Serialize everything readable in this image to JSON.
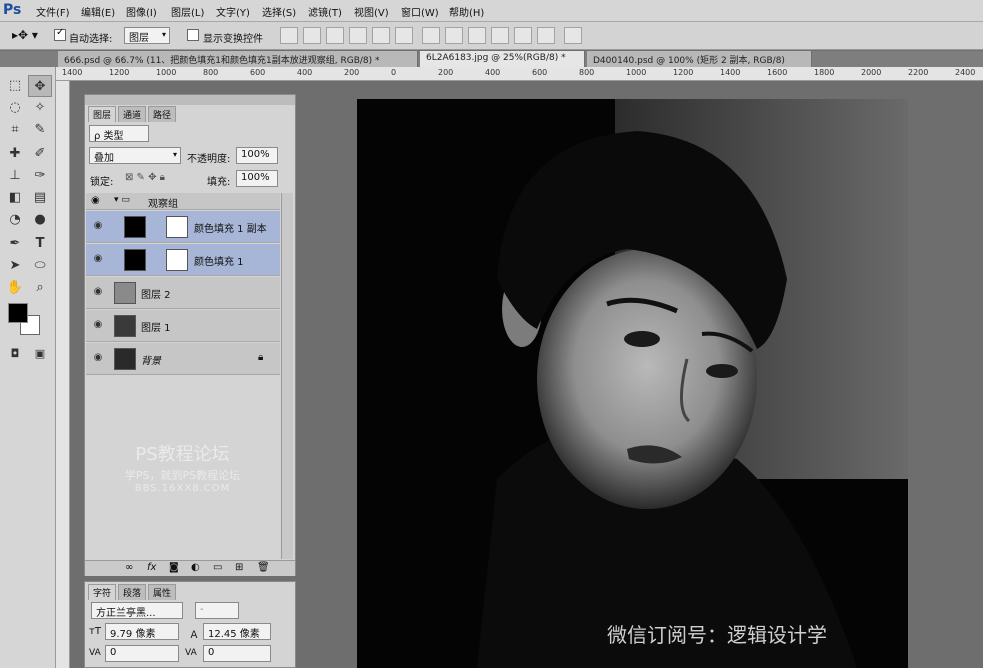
{
  "app": {
    "logo": "Ps"
  },
  "menu": [
    "文件(F)",
    "编辑(E)",
    "图像(I)",
    "图层(L)",
    "文字(Y)",
    "选择(S)",
    "滤镜(T)",
    "视图(V)",
    "窗口(W)",
    "帮助(H)"
  ],
  "options": {
    "auto_select_label": "自动选择:",
    "auto_select_value": "图层",
    "show_transform_label": "显示变换控件"
  },
  "tabs": [
    {
      "label": "666.psd @ 66.7% (11、把颜色填充1和颜色填充1副本放进观察组, RGB/8) *"
    },
    {
      "label": "6L2A6183.jpg @ 25%(RGB/8) *"
    },
    {
      "label": "D400140.psd @ 100% (矩形 2 副本, RGB/8)"
    }
  ],
  "ruler": {
    "labels": [
      "1400",
      "1200",
      "1000",
      "800",
      "600",
      "400",
      "200",
      "0",
      "200",
      "400",
      "600",
      "800",
      "1000",
      "1200",
      "1400",
      "1600",
      "1800",
      "2000",
      "2200",
      "2400"
    ]
  },
  "layers_panel": {
    "tabs": [
      "图层",
      "通道",
      "路径"
    ],
    "filter_label": "ρ 类型",
    "blend_mode": "叠加",
    "opacity_label": "不透明度:",
    "opacity_value": "100%",
    "lock_label": "锁定:",
    "fill_label": "填充:",
    "fill_value": "100%",
    "group_name": "观察组",
    "layers": [
      {
        "name": "颜色填充 1 副本"
      },
      {
        "name": "颜色填充 1"
      },
      {
        "name": "图层 2"
      },
      {
        "name": "图层 1"
      },
      {
        "name": "背景"
      }
    ],
    "watermark_title": "PS教程论坛",
    "watermark_sub": "学PS，就到PS教程论坛",
    "watermark_url": "BBS.16XX8.COM"
  },
  "char_panel": {
    "tabs": [
      "字符",
      "段落",
      "属性"
    ],
    "font_family": "方正兰亭黑...",
    "font_style": "-",
    "font_size": "9.79 像素",
    "leading": "12.45 像素",
    "kerning": "0",
    "tracking": "0"
  },
  "canvas": {
    "watermark": "微信订阅号：逻辑设计学"
  },
  "colors": {
    "ui_grey": "#d4d4d4",
    "selection_blue": "#a7b6d6",
    "canvas_bg": "#6e6e6e"
  }
}
